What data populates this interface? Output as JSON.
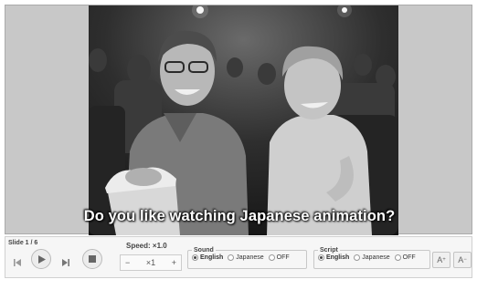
{
  "video": {
    "subtitle": "Do you like watching Japanese animation?"
  },
  "player": {
    "slide_counter": "Slide 1 / 6",
    "speed": {
      "label": "Speed: ×1.0",
      "minus": "−",
      "value": "×1",
      "plus": "+"
    },
    "sound": {
      "legend": "Sound",
      "options": [
        "English",
        "Japanese",
        "OFF"
      ],
      "selected": "English"
    },
    "script": {
      "legend": "Script",
      "options": [
        "English",
        "Japanese",
        "OFF"
      ],
      "selected": "English"
    },
    "font_increase": "A",
    "font_increase_mark": "+",
    "font_decrease": "A",
    "font_decrease_mark": "−"
  }
}
